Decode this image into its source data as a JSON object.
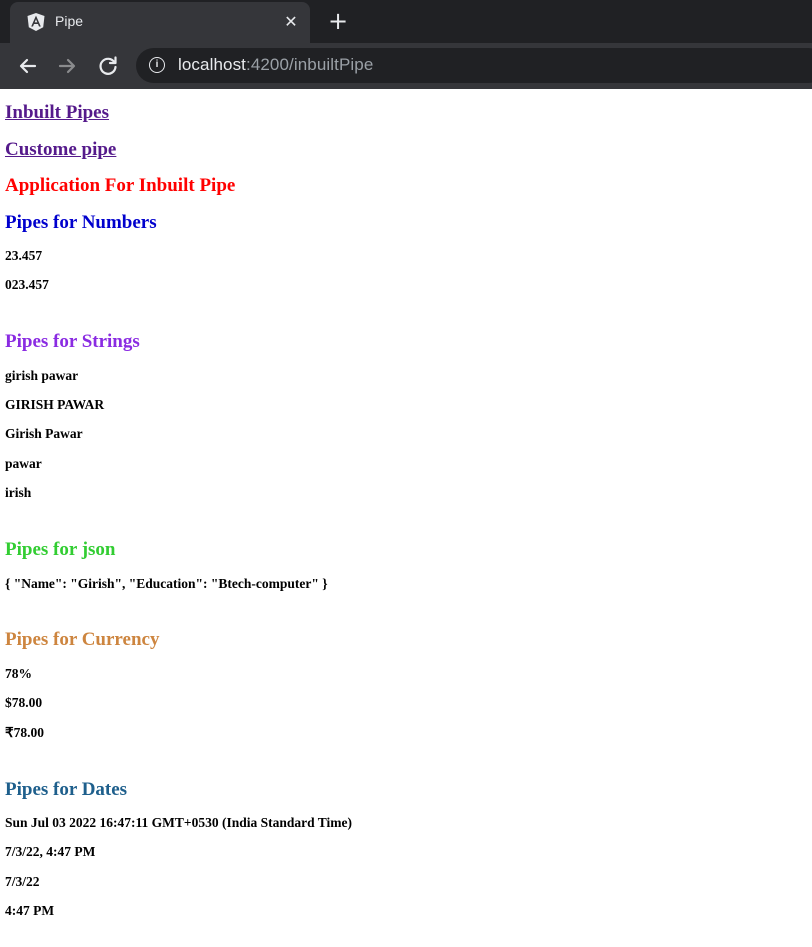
{
  "browser": {
    "tab_title": "Pipe",
    "url_host": "localhost",
    "url_rest": ":4200/inbuiltPipe"
  },
  "links": [
    {
      "label": "Inbuilt Pipes"
    },
    {
      "label": "Custome pipe"
    }
  ],
  "page_title": "Application For Inbuilt Pipe",
  "sections": {
    "numbers": {
      "heading": "Pipes for Numbers",
      "color": "#0000cd",
      "items": [
        "23.457",
        "023.457"
      ]
    },
    "strings": {
      "heading": "Pipes for Strings",
      "color": "#8a2be2",
      "items": [
        "girish pawar",
        "GIRISH PAWAR",
        "Girish Pawar",
        "pawar",
        "irish"
      ]
    },
    "json": {
      "heading": "Pipes for json",
      "color": "#32cd32",
      "items": [
        "{ \"Name\": \"Girish\", \"Education\": \"Btech-computer\" }"
      ]
    },
    "currency": {
      "heading": "Pipes for Currency",
      "color": "#cd853f",
      "items": [
        "78%",
        "$78.00",
        "₹78.00"
      ]
    },
    "dates": {
      "heading": "Pipes for Dates",
      "color": "#1e5f8c",
      "items": [
        "Sun Jul 03 2022 16:47:11 GMT+0530 (India Standard Time)",
        "7/3/22, 4:47 PM",
        "7/3/22",
        "4:47 PM"
      ]
    }
  },
  "colors": {
    "title": "#ff0000",
    "link": "#551a8b"
  },
  "icons": [
    "angular-logo-icon",
    "close-icon",
    "plus-icon",
    "back-arrow-icon",
    "forward-arrow-icon",
    "reload-icon",
    "info-icon"
  ]
}
